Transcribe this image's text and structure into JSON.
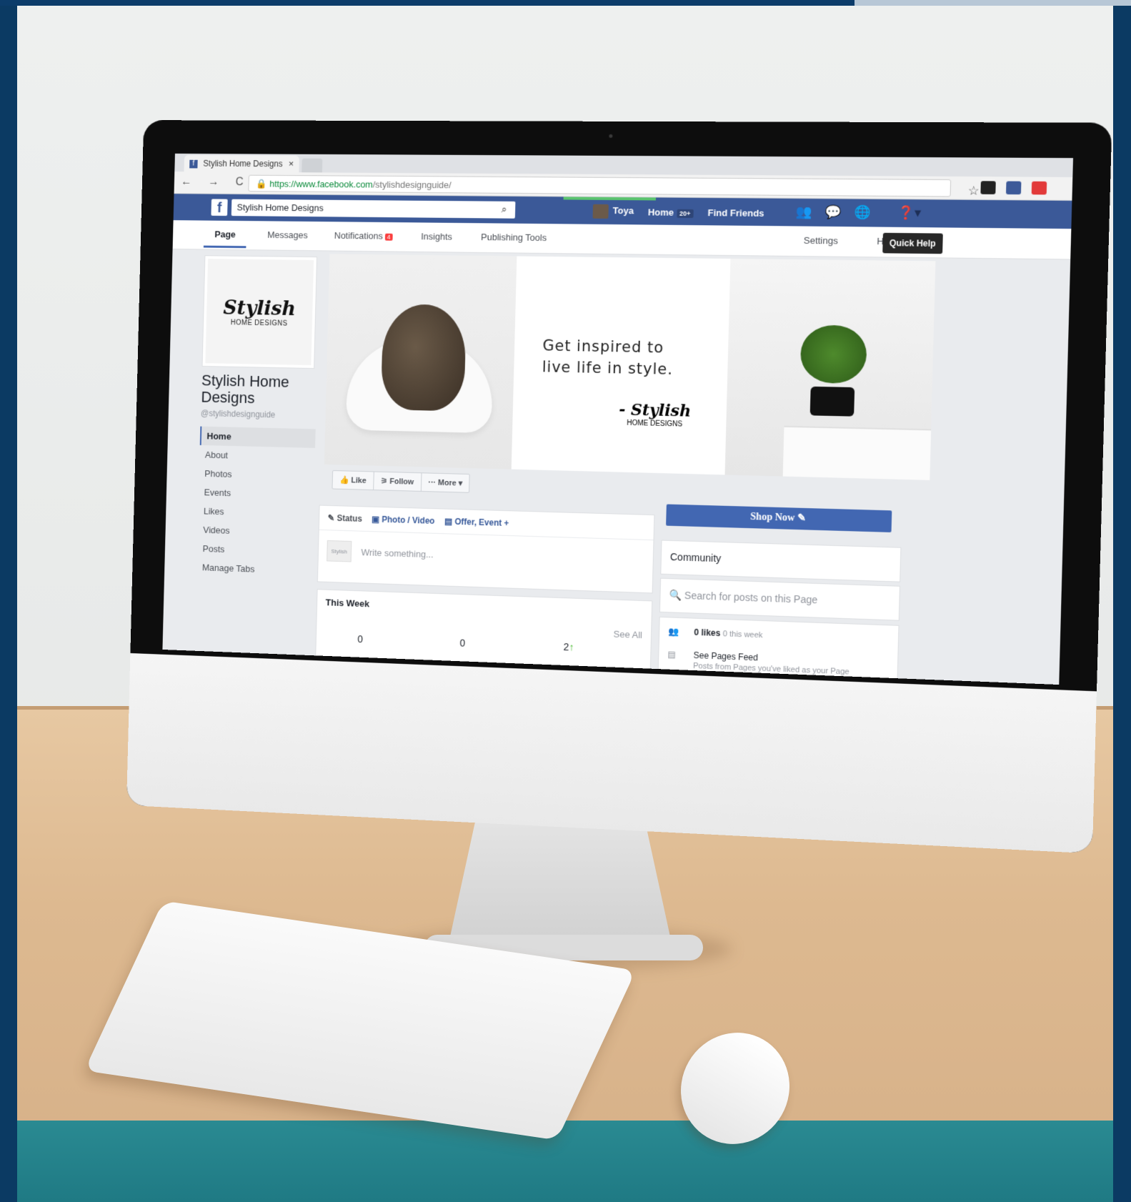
{
  "browser": {
    "tab_title": "Stylish Home Designs",
    "tab_close": "×",
    "url_domain": "https://www.facebook.com",
    "url_path": "/stylishdesignguide/",
    "nav_glyphs": "← → C ⌂"
  },
  "facebook_bar": {
    "logo": "f",
    "search_value": "Stylish Home Designs",
    "user_name": "Toya",
    "home_label": "Home",
    "home_badge": "20+",
    "find_friends": "Find Friends"
  },
  "page_tabs": [
    {
      "label": "Page"
    },
    {
      "label": "Messages"
    },
    {
      "label": "Notifications"
    },
    {
      "label": "Insights"
    },
    {
      "label": "Publishing Tools"
    },
    {
      "label": "Settings"
    },
    {
      "label": "He"
    }
  ],
  "notifications_badge": "4",
  "tooltip": "Quick Help",
  "profile": {
    "logo_word": "Stylish",
    "logo_sub": "HOME DESIGNS",
    "name": "Stylish Home Designs",
    "handle": "@stylishdesignguide"
  },
  "left_menu": [
    {
      "label": "Home"
    },
    {
      "label": "About"
    },
    {
      "label": "Photos"
    },
    {
      "label": "Events"
    },
    {
      "label": "Likes"
    },
    {
      "label": "Videos"
    },
    {
      "label": "Posts"
    },
    {
      "label": "Manage Tabs"
    }
  ],
  "cover": {
    "quote_line1": "Get inspired to",
    "quote_line2": "live life in style.",
    "sig_word": "- Stylish",
    "sig_sub": "HOME DESIGNS"
  },
  "actions": {
    "like": "Like",
    "follow": "Follow",
    "more": "··· More ▾"
  },
  "shop_now": "Shop Now",
  "composer": {
    "status": "Status",
    "photo_video": "Photo / Video",
    "offer_event": "Offer, Event +",
    "placeholder": "Write something...",
    "thumb_text": "Stylish"
  },
  "this_week": {
    "title": "This Week",
    "see_all": "See All",
    "values": [
      "0",
      "0",
      "2"
    ]
  },
  "sidebar_right": {
    "community": "Community",
    "search_placeholder": "Search for posts on this Page",
    "likes_label": "0 likes",
    "likes_sub": "0 this week",
    "feed_label": "See Pages Feed",
    "feed_sub": "Posts from Pages you've liked as your Page"
  }
}
